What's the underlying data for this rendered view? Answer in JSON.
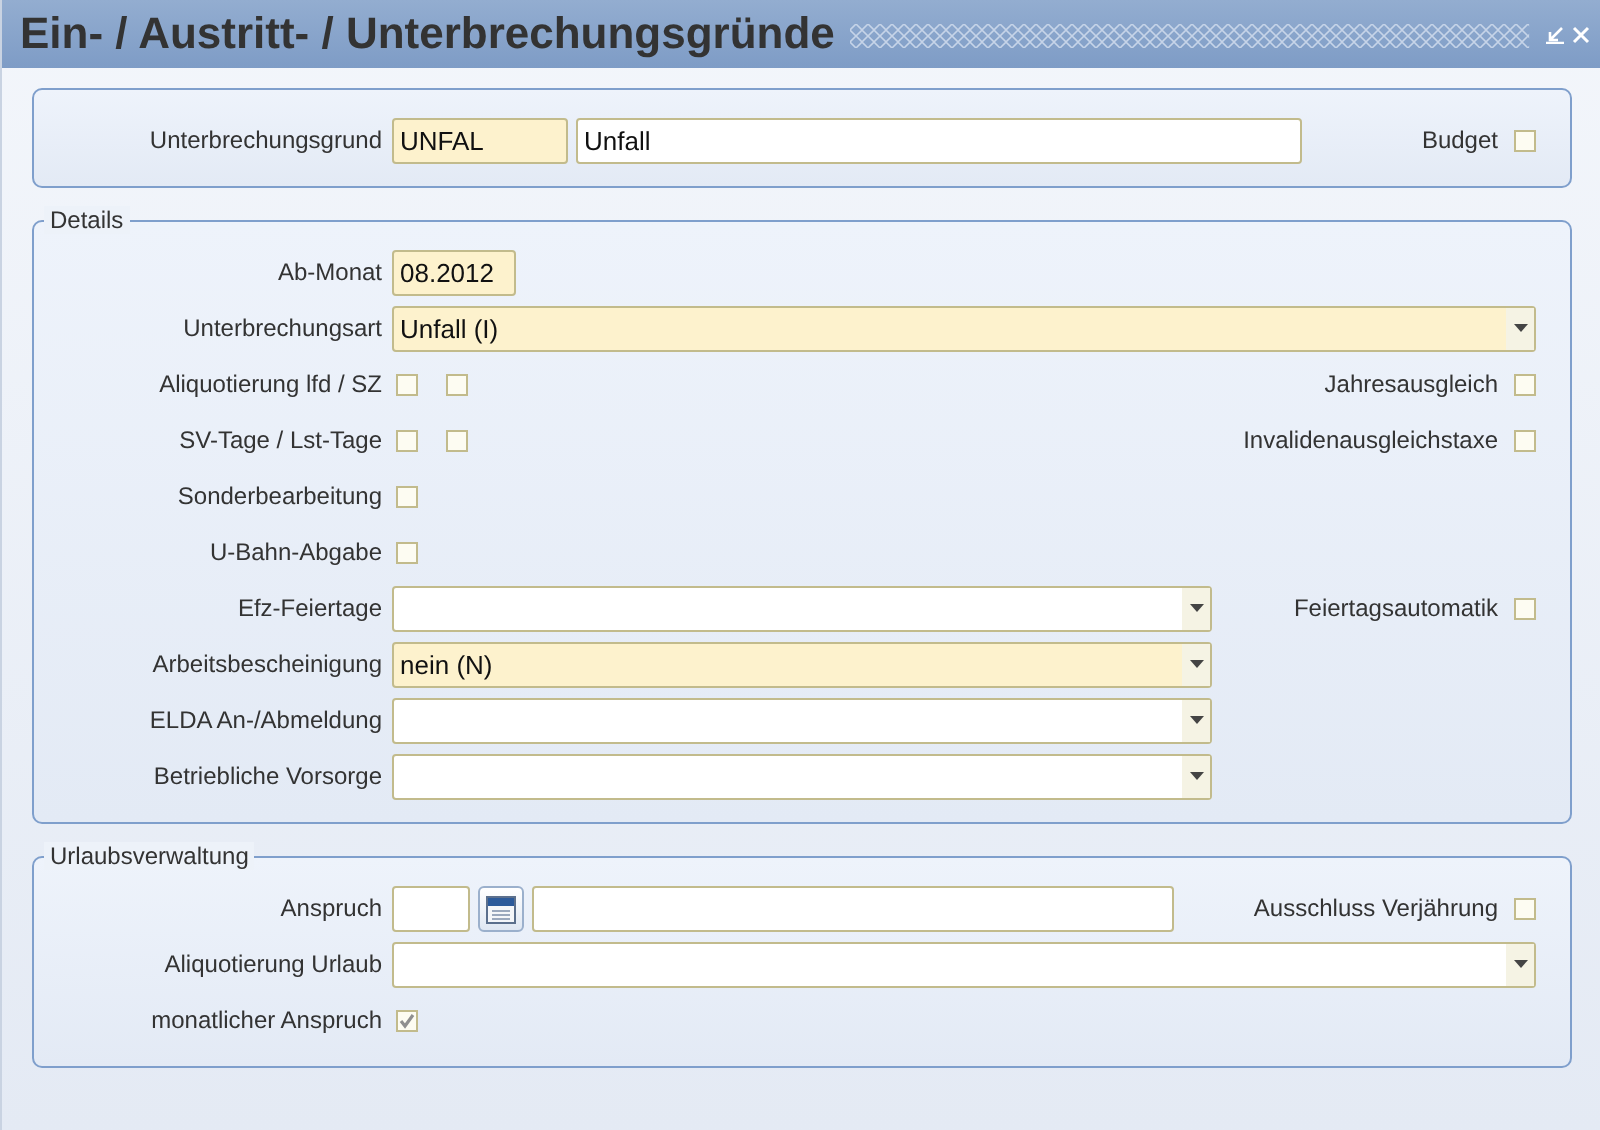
{
  "window": {
    "title": "Ein- / Austritt- / Unterbrechungsgründe"
  },
  "sections": [
    {
      "rows": [
        {
          "label": "Unterbrechungsgrund",
          "fields": [
            {
              "kind": "text",
              "value": "UNFAL",
              "required": true
            },
            {
              "kind": "text",
              "value": "Unfall",
              "required": false
            }
          ],
          "right": {
            "label": "Budget",
            "checked": false
          }
        }
      ]
    },
    {
      "legend": "Details",
      "rows": [
        {
          "label": "Ab-Monat",
          "fields": [
            {
              "kind": "text",
              "value": "08.2012",
              "required": true
            }
          ]
        },
        {
          "label": "Unterbrechungsart",
          "fields": [
            {
              "kind": "combo",
              "value": "Unfall (I)",
              "required": true
            }
          ]
        },
        {
          "label": "Aliquotierung lfd / SZ",
          "fields": [
            {
              "kind": "checkbox",
              "checked": false
            },
            {
              "kind": "checkbox",
              "checked": false
            }
          ],
          "right": {
            "label": "Jahresausgleich",
            "checked": false
          }
        },
        {
          "label": "SV-Tage / Lst-Tage",
          "fields": [
            {
              "kind": "checkbox",
              "checked": false
            },
            {
              "kind": "checkbox",
              "checked": false
            }
          ],
          "right": {
            "label": "Invalidenausgleichstaxe",
            "checked": false
          }
        },
        {
          "label": "Sonderbearbeitung",
          "fields": [
            {
              "kind": "checkbox",
              "checked": false
            }
          ]
        },
        {
          "label": "U-Bahn-Abgabe",
          "fields": [
            {
              "kind": "checkbox",
              "checked": false
            }
          ]
        },
        {
          "label": "Efz-Feiertage",
          "fields": [
            {
              "kind": "combo",
              "required": false
            }
          ],
          "right": {
            "label": "Feiertagsautomatik",
            "checked": false
          }
        },
        {
          "label": "Arbeitsbescheinigung",
          "fields": [
            {
              "kind": "combo",
              "value": "nein (N)",
              "required": true
            }
          ]
        },
        {
          "label": "ELDA An-/Abmeldung",
          "fields": [
            {
              "kind": "combo",
              "required": false
            }
          ]
        },
        {
          "label": "Betriebliche Vorsorge",
          "fields": [
            {
              "kind": "combo",
              "required": false
            }
          ]
        }
      ]
    },
    {
      "legend": "Urlaubsverwaltung",
      "rows": [
        {
          "label": "Anspruch",
          "fields": [
            {
              "kind": "text",
              "required": false
            },
            {
              "kind": "calendar"
            },
            {
              "kind": "text",
              "required": false
            }
          ],
          "right": {
            "label": "Ausschluss Verjährung",
            "checked": false
          }
        },
        {
          "label": "Aliquotierung Urlaub",
          "fields": [
            {
              "kind": "combo",
              "required": false
            }
          ]
        },
        {
          "label": "monatlicher Anspruch",
          "fields": [
            {
              "kind": "checkbox",
              "checked": true
            }
          ]
        }
      ]
    }
  ]
}
